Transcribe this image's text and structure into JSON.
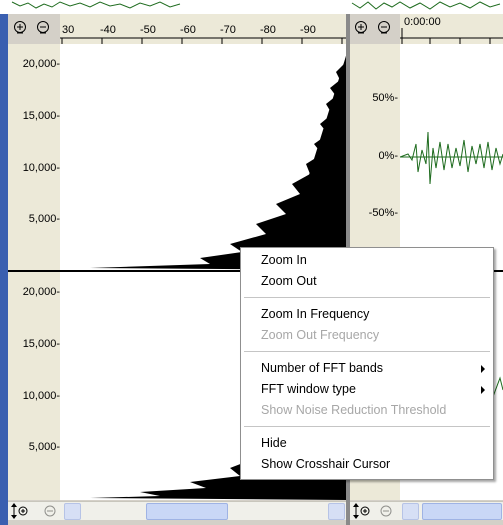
{
  "left_panel": {
    "freq_ruler_ticks": [
      "30",
      "-40",
      "-50",
      "-60",
      "-70",
      "-80",
      "-90"
    ],
    "upper_y_ticks": [
      "20,000-",
      "15,000-",
      "10,000-",
      "5,000-"
    ],
    "lower_y_ticks": [
      "20,000-",
      "15,000-",
      "10,000-",
      "5,000-"
    ]
  },
  "right_panel": {
    "time_label": "0:00:00",
    "amp_ticks": [
      "50%-",
      "0%-",
      "-50%-"
    ]
  },
  "context_menu": {
    "items": [
      {
        "label": "Zoom In",
        "enabled": true
      },
      {
        "label": "Zoom Out",
        "enabled": true
      },
      {
        "label": "Zoom In Frequency",
        "enabled": true
      },
      {
        "label": "Zoom Out Frequency",
        "enabled": false
      },
      {
        "label": "Number of FFT bands",
        "enabled": true,
        "submenu": true
      },
      {
        "label": "FFT window type",
        "enabled": true,
        "submenu": true
      },
      {
        "label": "Show Noise Reduction Threshold",
        "enabled": false
      },
      {
        "label": "Hide",
        "enabled": true
      },
      {
        "label": "Show Crosshair Cursor",
        "enabled": true
      }
    ]
  },
  "icons": {
    "zoom_in": "zoom-in-icon",
    "zoom_out": "zoom-out-icon",
    "vertical_zoom": "vertical-zoom-icon"
  },
  "colors": {
    "waveform_green": "#1e6b1e",
    "spectrum_black": "#000000",
    "menu_disabled": "#a7a7a7"
  }
}
